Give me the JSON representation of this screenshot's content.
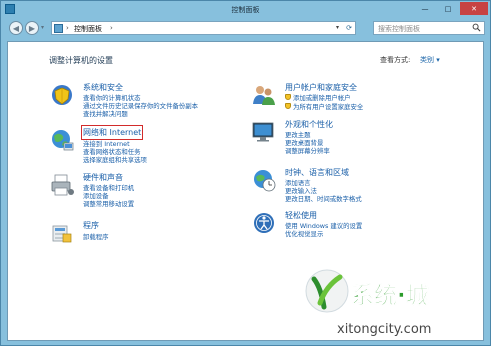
{
  "window": {
    "title": "控制面板"
  },
  "address": {
    "crumb": "控制面板",
    "search_placeholder": "搜索控制面板"
  },
  "header": {
    "heading": "调整计算机的设置",
    "view_by": "查看方式:",
    "view_value": "类别 ▾"
  },
  "categories": {
    "system": {
      "title": "系统和安全",
      "links": [
        "查看你的计算机状态",
        "通过文件历史记录保存你的文件备份副本",
        "查找并解决问题"
      ]
    },
    "network": {
      "title": "网络和 Internet",
      "links": [
        "连接到 Internet",
        "查看网络状态和任务",
        "选择家庭组和共享选项"
      ]
    },
    "hardware": {
      "title": "硬件和声音",
      "links": [
        "查看设备和打印机",
        "添加设备",
        "调整常用移动设置"
      ]
    },
    "programs": {
      "title": "程序",
      "links": [
        "卸载程序"
      ]
    },
    "accounts": {
      "title": "用户帐户和家庭安全",
      "links": [
        "添加或删除用户帐户",
        "为所有用户设置家庭安全"
      ]
    },
    "appearance": {
      "title": "外观和个性化",
      "links": [
        "更改主题",
        "更改桌面背景",
        "调整屏幕分辨率"
      ]
    },
    "clock": {
      "title": "时钟、语言和区域",
      "links": [
        "添加语言",
        "更改输入法",
        "更改日期、时间或数字格式"
      ]
    },
    "ease": {
      "title": "轻松使用",
      "links": [
        "使用 Windows 建议的设置",
        "优化视觉显示"
      ]
    }
  },
  "watermark": {
    "brand": "系统·城",
    "url": "xitongcity.com"
  },
  "colors": {
    "link": "#1a5fa8",
    "highlight": "#d22b2b",
    "frame": "#87c0dd"
  }
}
